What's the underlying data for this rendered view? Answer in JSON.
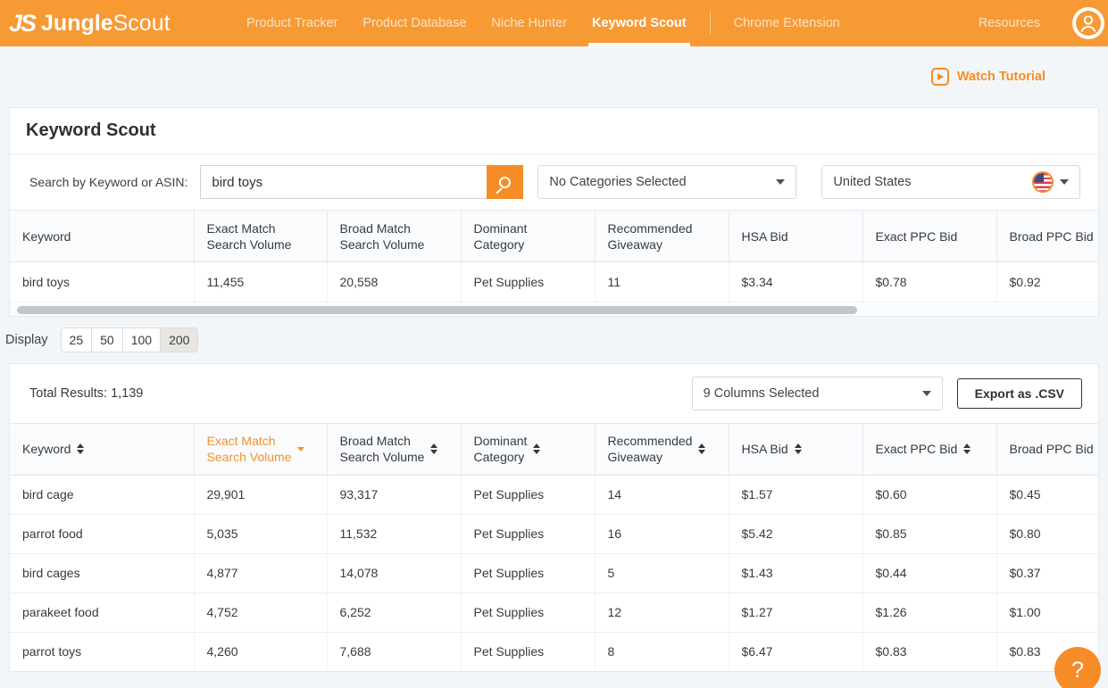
{
  "nav": {
    "brand_mark": "JS",
    "brand_bold": "Jungle",
    "brand_light": "Scout",
    "items": [
      {
        "label": "Product Tracker",
        "active": false
      },
      {
        "label": "Product Database",
        "active": false
      },
      {
        "label": "Niche Hunter",
        "active": false
      },
      {
        "label": "Keyword Scout",
        "active": true
      },
      {
        "label": "Chrome Extension",
        "active": false
      }
    ],
    "resources_label": "Resources",
    "avatar_icon": "user-icon"
  },
  "tutorial": {
    "label": "Watch Tutorial",
    "icon": "play-icon"
  },
  "page": {
    "title": "Keyword Scout"
  },
  "search": {
    "label": "Search by Keyword or ASIN:",
    "value": "bird toys",
    "placeholder": "",
    "button_icon": "search-icon",
    "categories_value": "No Categories Selected",
    "country_value": "United States",
    "country_flag_icon": "us-flag-icon"
  },
  "summary_table": {
    "columns": [
      "Keyword",
      "Exact Match\nSearch Volume",
      "Broad Match\nSearch Volume",
      "Dominant\nCategory",
      "Recommended\nGiveaway",
      "HSA Bid",
      "Exact PPC Bid",
      "Broad PPC Bid",
      ""
    ],
    "rows": [
      {
        "keyword": "bird toys",
        "exact_match_search_volume": "11,455",
        "broad_match_search_volume": "20,558",
        "dominant_category": "Pet Supplies",
        "recommended_giveaway": "11",
        "hsa_bid": "$3.34",
        "exact_ppc_bid": "$0.78",
        "broad_ppc_bid": "$0.92",
        "extra": ""
      }
    ]
  },
  "display": {
    "label": "Display",
    "options": [
      "25",
      "50",
      "100",
      "200"
    ],
    "selected": "200"
  },
  "results": {
    "total_results_label": "Total Results: 1,139",
    "columns_selected": "9 Columns Selected",
    "export_label": "Export as .CSV",
    "columns": [
      {
        "label": "Keyword",
        "sortable": true,
        "sorted": false
      },
      {
        "label": "Exact Match\nSearch Volume",
        "sortable": true,
        "sorted": true
      },
      {
        "label": "Broad Match\nSearch Volume",
        "sortable": true,
        "sorted": false
      },
      {
        "label": "Dominant\nCategory",
        "sortable": true,
        "sorted": false
      },
      {
        "label": "Recommended\nGiveaway",
        "sortable": true,
        "sorted": false
      },
      {
        "label": "HSA Bid",
        "sortable": true,
        "sorted": false
      },
      {
        "label": "Exact PPC Bid",
        "sortable": true,
        "sorted": false
      },
      {
        "label": "Broad PPC Bid",
        "sortable": false,
        "sorted": false
      },
      {
        "label": "",
        "sortable": false,
        "sorted": false
      }
    ],
    "rows": [
      {
        "keyword": "bird cage",
        "exact_match_search_volume": "29,901",
        "broad_match_search_volume": "93,317",
        "dominant_category": "Pet Supplies",
        "recommended_giveaway": "14",
        "hsa_bid": "$1.57",
        "exact_ppc_bid": "$0.60",
        "broad_ppc_bid": "$0.45",
        "extra": ""
      },
      {
        "keyword": "parrot food",
        "exact_match_search_volume": "5,035",
        "broad_match_search_volume": "11,532",
        "dominant_category": "Pet Supplies",
        "recommended_giveaway": "16",
        "hsa_bid": "$5.42",
        "exact_ppc_bid": "$0.85",
        "broad_ppc_bid": "$0.80",
        "extra": ""
      },
      {
        "keyword": "bird cages",
        "exact_match_search_volume": "4,877",
        "broad_match_search_volume": "14,078",
        "dominant_category": "Pet Supplies",
        "recommended_giveaway": "5",
        "hsa_bid": "$1.43",
        "exact_ppc_bid": "$0.44",
        "broad_ppc_bid": "$0.37",
        "extra": ""
      },
      {
        "keyword": "parakeet food",
        "exact_match_search_volume": "4,752",
        "broad_match_search_volume": "6,252",
        "dominant_category": "Pet Supplies",
        "recommended_giveaway": "12",
        "hsa_bid": "$1.27",
        "exact_ppc_bid": "$1.26",
        "broad_ppc_bid": "$1.00",
        "extra": ""
      },
      {
        "keyword": "parrot toys",
        "exact_match_search_volume": "4,260",
        "broad_match_search_volume": "7,688",
        "dominant_category": "Pet Supplies",
        "recommended_giveaway": "8",
        "hsa_bid": "$6.47",
        "exact_ppc_bid": "$0.83",
        "broad_ppc_bid": "$0.83",
        "extra": ""
      }
    ]
  },
  "help": {
    "label": "?",
    "icon": "question-mark-icon"
  },
  "colors": {
    "brand_orange": "#f79a34",
    "accent_orange": "#f68c28",
    "link_orange": "#f2912f",
    "page_bg": "#f2f6f9"
  }
}
